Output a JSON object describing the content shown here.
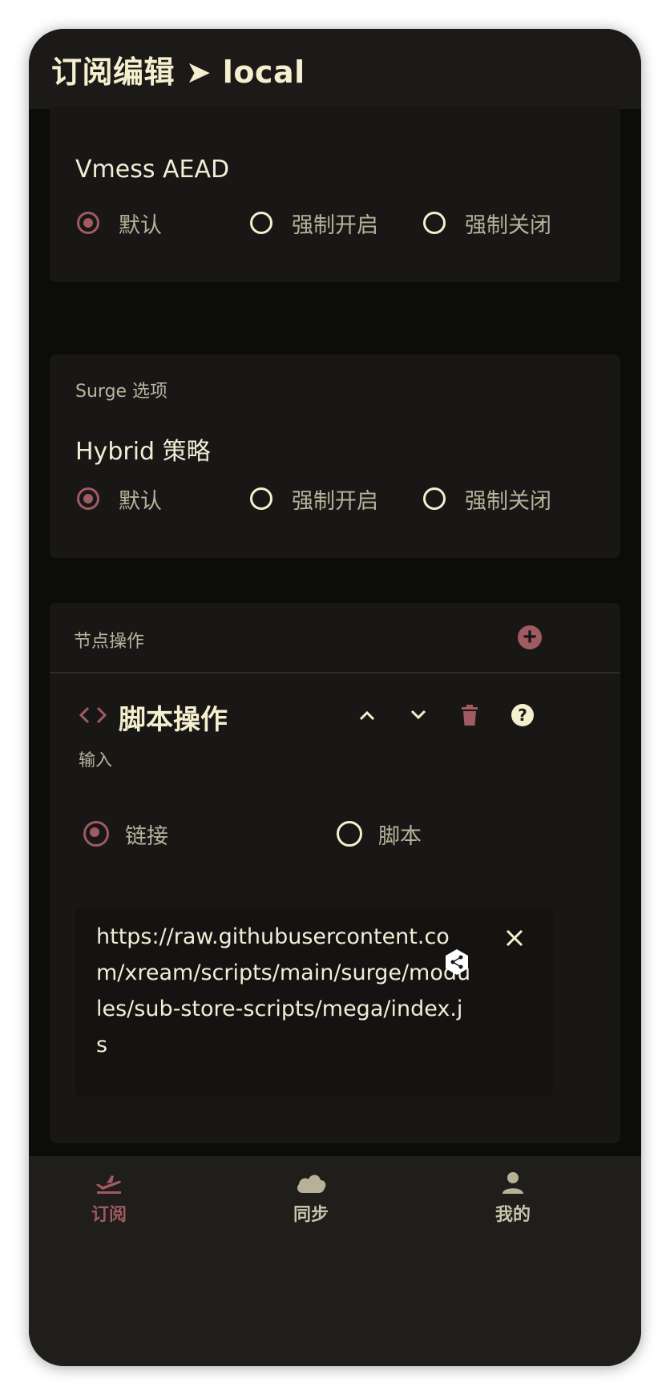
{
  "appbar": {
    "title": "订阅编辑 ➤ local"
  },
  "vmess_card": {
    "title": "Vmess AEAD",
    "options": [
      "默认",
      "强制开启",
      "强制关闭"
    ],
    "selected": "默认"
  },
  "surge_card": {
    "section_label": "Surge 选项",
    "title": "Hybrid 策略",
    "options": [
      "默认",
      "强制开启",
      "强制关闭"
    ],
    "selected": "默认"
  },
  "node_ops_card": {
    "section_label": "节点操作",
    "add_icon": "plus-circle-icon",
    "script_op": {
      "code_icon": "code-brackets-icon",
      "title": "脚本操作",
      "input_label": "输入",
      "input_options": [
        "链接",
        "脚本"
      ],
      "input_selected": "链接",
      "url_value": "https://raw.githubusercontent.com/xream/scripts/main/surge/modules/sub-store-scripts/mega/index.js",
      "action_icons": [
        "chevron-up-icon",
        "chevron-down-icon",
        "trash-icon",
        "help-icon",
        "close-icon"
      ]
    }
  },
  "bottom_nav": {
    "items": [
      {
        "label": "订阅",
        "icon": "plane-takeoff-icon",
        "active": true
      },
      {
        "label": "同步",
        "icon": "cloud-icon",
        "active": false
      },
      {
        "label": "我的",
        "icon": "person-icon",
        "active": false
      }
    ]
  },
  "colors": {
    "accent": "#9f5a62",
    "text_primary": "#f4efcf",
    "text_secondary": "#b7b19a",
    "background": "#0c0c0b",
    "card": "#181716"
  }
}
